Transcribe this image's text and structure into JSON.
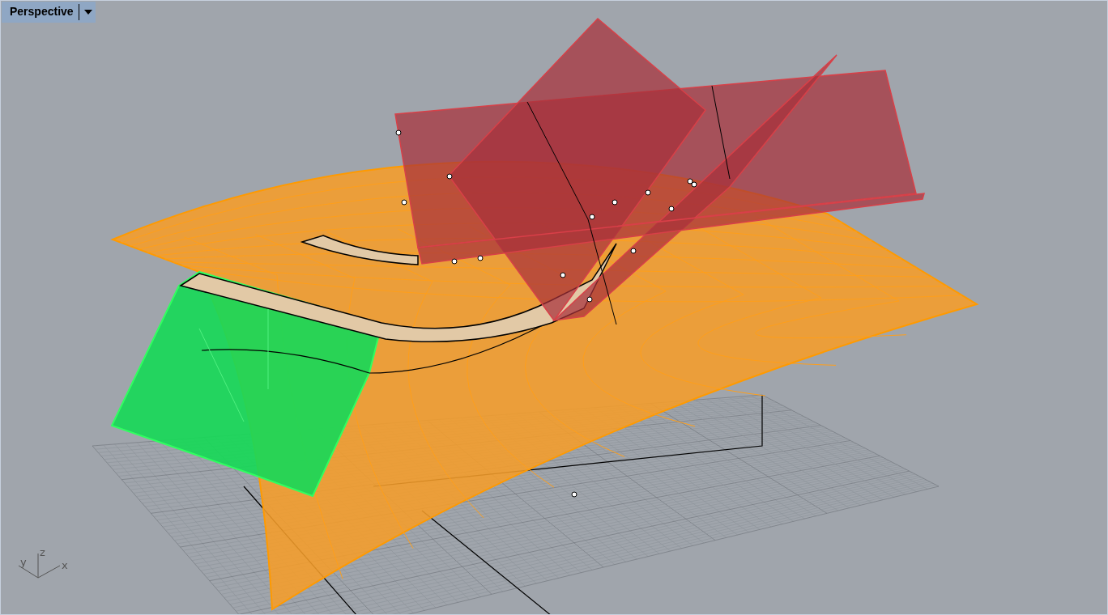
{
  "viewport": {
    "title": "Perspective"
  },
  "axis_labels": [
    "y",
    "z",
    "x"
  ]
}
